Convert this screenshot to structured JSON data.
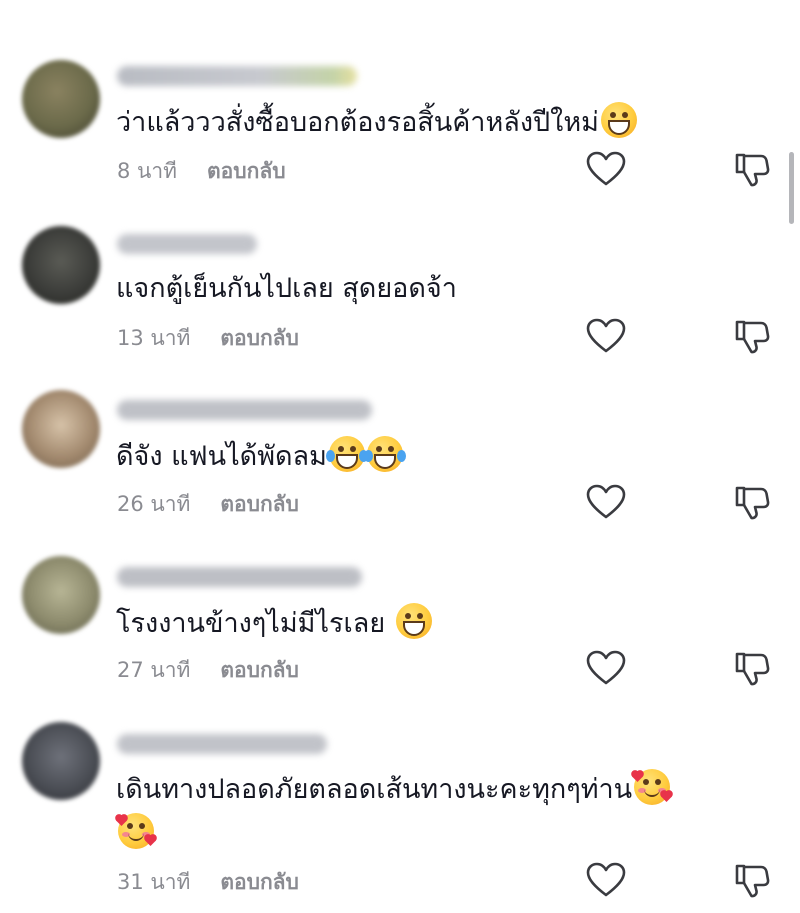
{
  "comments": [
    {
      "text": "ว่าแล้วววสั่งซื้อบอกต้องรอสิ้นค้าหลังปีใหม่",
      "emoji": [
        "grin"
      ],
      "time": "8 นาที",
      "reply": "ตอบกลับ",
      "avatar_color": "#6b6a4a",
      "username_width": 240
    },
    {
      "text": "แจกตู้เย็นกันไปเลย สุดยอดจ้า",
      "emoji": [],
      "time": "13 นาที",
      "reply": "ตอบกลับ",
      "avatar_color": "#3c3d3a",
      "username_width": 140
    },
    {
      "text": "ดีจัง แฟนได้พัดลม",
      "emoji": [
        "tears-of-joy",
        "tears-of-joy"
      ],
      "time": "26 นาที",
      "reply": "ตอบกลับ",
      "avatar_color": "#a38a6f",
      "username_width": 255
    },
    {
      "text": "โรงงานข้างๆไม่มีไรเลย ",
      "emoji": [
        "grin"
      ],
      "time": "27 นาที",
      "reply": "ตอบกลับ",
      "avatar_color": "#8d8b6d",
      "username_width": 245
    },
    {
      "text": "เดินทางปลอดภัยตลอดเส้นทางนะคะทุกๆท่าน",
      "emoji": [
        "smiling-hearts",
        "smiling-hearts"
      ],
      "time": "31 นาที",
      "reply": "ตอบกลับ",
      "avatar_color": "#4b4e55",
      "username_width": 210
    }
  ],
  "colors": {
    "text": "#161823",
    "meta": "#8a8b91",
    "icon": "#3a3b40"
  },
  "icons": {
    "like": "heart-outline-icon",
    "dislike": "thumbs-down-outline-icon"
  }
}
